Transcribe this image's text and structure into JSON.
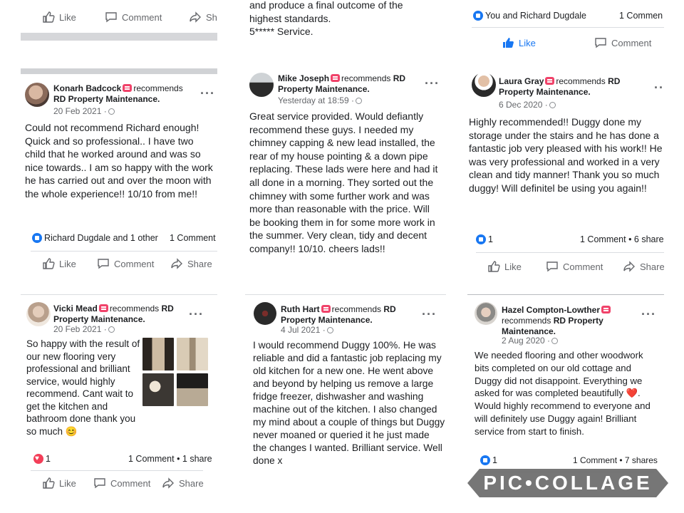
{
  "labels": {
    "like": "Like",
    "comment": "Comment",
    "share": "Share",
    "share_cut": "Sh",
    "like_cut": "Like",
    "comment_cut": "Comment",
    "recommends": "recommends",
    "page": "RD Property Maintenance",
    "page_dot": "RD Property Maintenance.",
    "rd": "RD",
    "property_dot": "Property Maintenance."
  },
  "top": {
    "mid_text": [
      "and produce a final outcome of the",
      "highest standards.",
      "5***** Service."
    ],
    "right_reactions": "You and Richard Dugdale",
    "right_counts": "1 Commen"
  },
  "posts": [
    {
      "name": "Konarh Badcock",
      "date": "20 Feb 2021 ·",
      "text": "Could not recommend Richard enough! Quick and so professional.. I have two child that he worked around and was so nice towards.. I am so happy with the work he has carried out and over the moon with the whole experience!! 10/10 from me!!",
      "reactions": "Richard Dugdale and 1 other",
      "counts": "1 Comment"
    },
    {
      "name": "Mike Joseph",
      "date": "Yesterday at 18:59 ·",
      "text": "Great service provided. Would defiantly recommend these guys. I needed my chimney capping & new lead installed, the rear of my house pointing & a down pipe replacing. These lads were here and had it all done in a morning. They sorted out the chimney with some further work and was more than reasonable with the price. Will be booking them in for some more work in the summer. Very clean, tidy and decent company!! 10/10. cheers lads!!"
    },
    {
      "name": "Laura Gray",
      "date": "6 Dec 2020 ·",
      "text": "Highly recommended!! Duggy done my storage under the stairs and he has done a fantastic job very pleased with his work!! He was very professional and worked in a very clean and tidy manner! Thank you so much duggy! Will definitel be using you again!!",
      "reactions": "1",
      "counts": "1 Comment • 6 share"
    },
    {
      "name": "Vicki Mead",
      "date": "20 Feb 2021 ·",
      "text": "So happy with the result of our new flooring very professional and brilliant service, would highly recommend. Cant wait to get the kitchen and bathroom done thank you so much 😊",
      "reactions": "1",
      "counts": "1 Comment • 1 share"
    },
    {
      "name": "Ruth Hart",
      "date": "4 Jul 2021 ·",
      "text": "I would recommend Duggy 100%. He was reliable and did a fantastic job replacing my old kitchen for a new one. He went above and beyond by helping us remove a large fridge freezer, dishwasher and washing machine out of the kitchen. I also changed my mind about a couple of things but Duggy never moaned or queried it he just made the changes I wanted. Brilliant service. Well done x"
    },
    {
      "name": "Hazel Compton-Lowther",
      "date": "2 Aug 2020 ·",
      "text": "We needed flooring and other woodwork bits completed on our old cottage and Duggy did not disappoint. Everything we asked for was completed beautifully ❤️. Would highly recommend to everyone and will definitely use Duggy again! Brilliant service from start to finish.",
      "reactions": "1",
      "counts": "1 Comment • 7 shares"
    }
  ],
  "watermark": "PIC•COLLAGE",
  "colors": {
    "link_blue": "#1877f2",
    "text": "#1c1e21",
    "muted": "#65676b",
    "heart": "#f33e58",
    "rec_badge": "#f0436a"
  }
}
